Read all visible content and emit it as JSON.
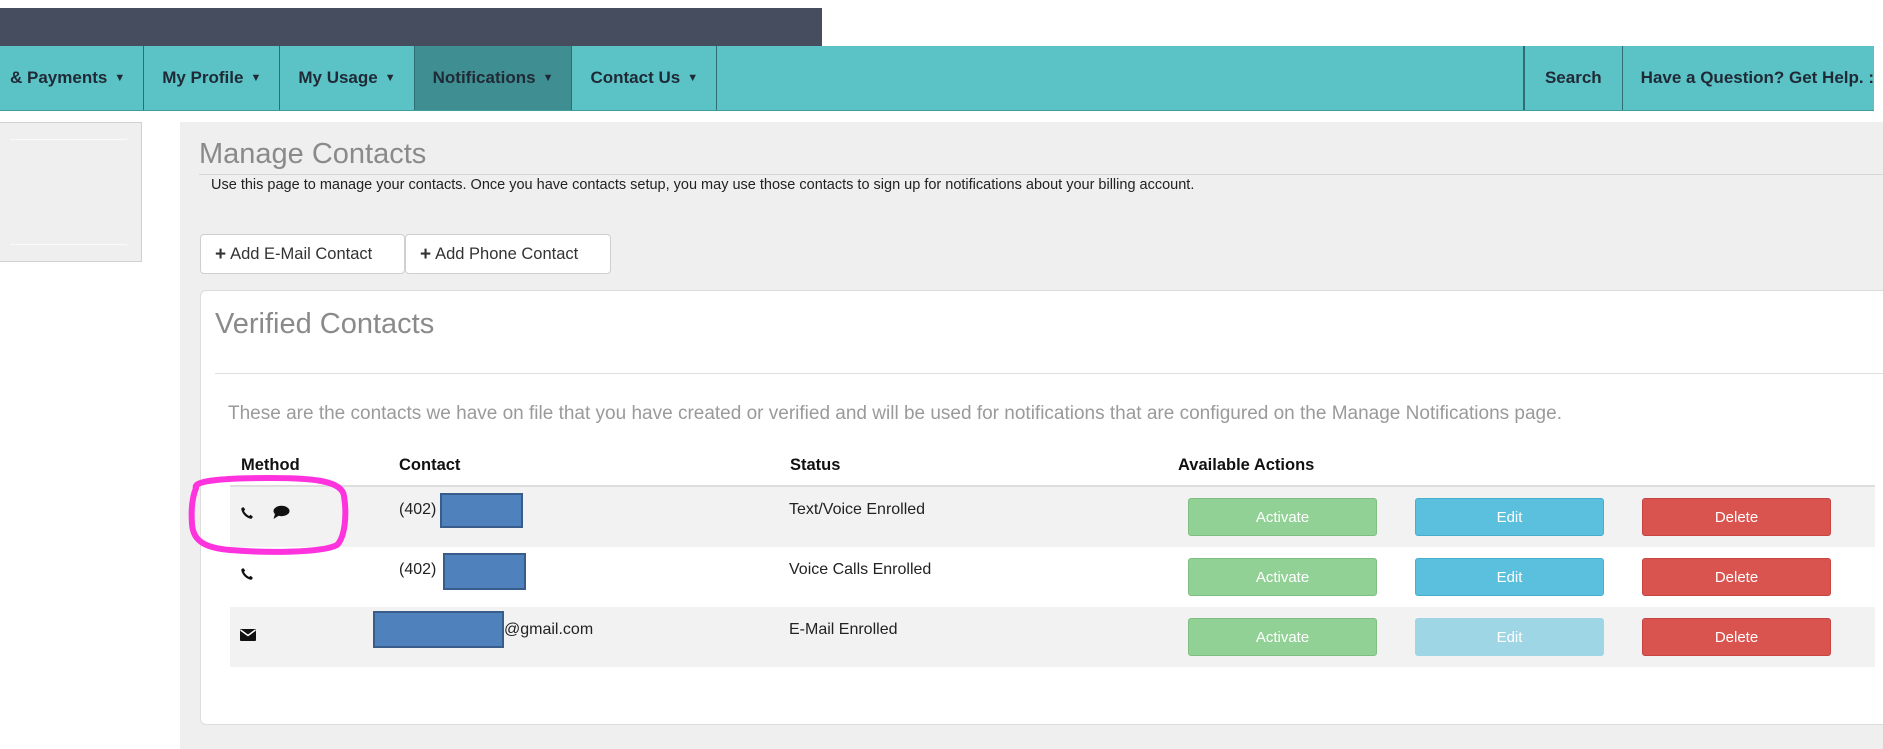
{
  "nav": {
    "items": [
      {
        "label": "& Payments"
      },
      {
        "label": "My Profile"
      },
      {
        "label": "My Usage"
      },
      {
        "label": "Notifications"
      },
      {
        "label": "Contact Us"
      }
    ],
    "search_label": "Search",
    "help_label": "Have a Question? Get Help. :"
  },
  "page": {
    "title": "Manage Contacts",
    "description": "Use this page to manage your contacts. Once you have contacts setup, you may use those contacts to sign up for notifications about your billing account."
  },
  "buttons": {
    "add_email": "Add E-Mail Contact",
    "add_phone": "Add Phone Contact"
  },
  "verified": {
    "title": "Verified Contacts",
    "description": "These are the contacts we have on file that you have created or verified and will be used for notifications that are configured on the Manage Notifications page.",
    "columns": [
      "Method",
      "Contact",
      "Status",
      "Available Actions"
    ],
    "rows": [
      {
        "methods": [
          "phone-icon",
          "chat-bubble-icon"
        ],
        "contact": "(402)",
        "status": "Text/Voice Enrolled",
        "edit_disabled": false
      },
      {
        "methods": [
          "phone-icon"
        ],
        "contact": "(402)",
        "status": "Voice Calls Enrolled",
        "edit_disabled": false
      },
      {
        "methods": [
          "envelope-icon"
        ],
        "contact": "@gmail.com",
        "status": "E-Mail Enrolled",
        "edit_disabled": true
      }
    ],
    "actions": {
      "activate": "Activate",
      "edit": "Edit",
      "delete": "Delete"
    }
  },
  "colors": {
    "navbar": "#5bc2c6",
    "navbar_active": "#3f8e92",
    "topbar_dark": "#454d5e",
    "activate": "#92d195",
    "edit": "#5bc0de",
    "delete": "#d9534f",
    "redaction": "#4f81bd",
    "annotation": "#ff33dd"
  }
}
